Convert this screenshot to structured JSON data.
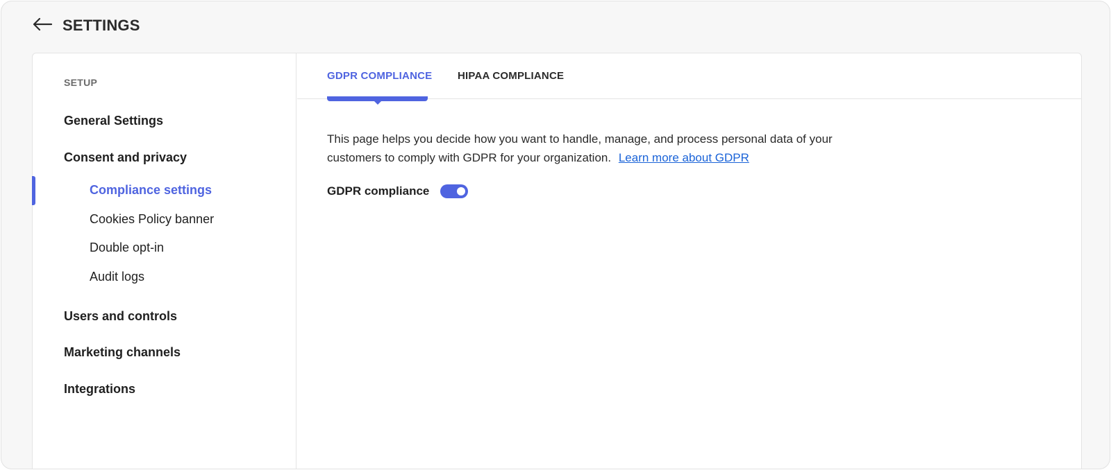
{
  "header": {
    "back_icon": "arrow-left-icon",
    "title": "SETTINGS"
  },
  "sidebar": {
    "section_title": "SETUP",
    "items": [
      {
        "label": "General Settings"
      },
      {
        "label": "Consent and privacy",
        "children": [
          {
            "label": "Compliance settings",
            "active": true
          },
          {
            "label": "Cookies Policy banner"
          },
          {
            "label": "Double opt-in"
          },
          {
            "label": "Audit logs"
          }
        ]
      },
      {
        "label": "Users and controls"
      },
      {
        "label": "Marketing channels"
      },
      {
        "label": "Integrations"
      }
    ]
  },
  "tabs": [
    {
      "label": "GDPR COMPLIANCE",
      "active": true
    },
    {
      "label": "HIPAA COMPLIANCE",
      "active": false
    }
  ],
  "main": {
    "description": "This page helps you decide how you want to handle, manage, and process personal data of your customers to comply with GDPR for your organization.",
    "learn_more_link": "Learn more about GDPR",
    "toggle": {
      "label": "GDPR compliance",
      "enabled": true
    }
  },
  "colors": {
    "accent": "#4f64e0",
    "link": "#1a63d8"
  }
}
